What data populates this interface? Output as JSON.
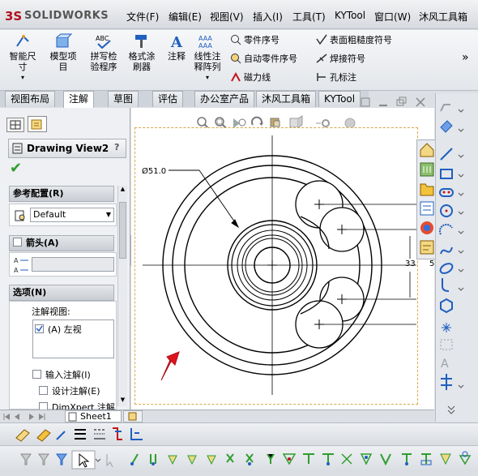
{
  "app": {
    "logo_mark": "3S",
    "logo_text": "SOLIDWORKS"
  },
  "menu": [
    "文件(F)",
    "编辑(E)",
    "视图(V)",
    "插入(I)",
    "工具(T)",
    "KYTool",
    "窗口(W)",
    "沐风工具箱"
  ],
  "ribbon": {
    "big_buttons": [
      {
        "label": "智能尺\n寸",
        "icon": "smart-dimension-icon"
      },
      {
        "label": "模型项\n目",
        "icon": "model-items-icon"
      },
      {
        "label": "拼写检\n验程序",
        "icon": "spell-check-icon"
      },
      {
        "label": "格式涂\n刷器",
        "icon": "format-painter-icon"
      },
      {
        "label": "注释",
        "icon": "note-icon"
      },
      {
        "label": "线性注\n释阵列",
        "icon": "linear-note-pattern-icon"
      }
    ],
    "small_buttons": [
      {
        "label": "零件序号",
        "icon": "balloon-icon"
      },
      {
        "label": "自动零件序号",
        "icon": "auto-balloon-icon"
      },
      {
        "label": "磁力线",
        "icon": "magnetic-line-icon"
      },
      {
        "label": "表面粗糙度符号",
        "icon": "surface-finish-icon"
      },
      {
        "label": "焊接符号",
        "icon": "weld-symbol-icon"
      },
      {
        "label": "孔标注",
        "icon": "hole-callout-icon"
      }
    ],
    "more_glyph": "»"
  },
  "tabs": [
    "视图布局",
    "注解",
    "草图",
    "评估",
    "办公室产品",
    "沐风工具箱",
    "KYTool"
  ],
  "active_tab": "注解",
  "panel": {
    "title": "Drawing View2",
    "help_glyph": "?",
    "ok_glyph": "✔",
    "sections": {
      "config": "参考配置(R)",
      "config_value": "Default",
      "arrow": "箭头(A)",
      "options": "选项(N)",
      "note_view_label": "注解视图:",
      "note_view_item": "(A) 左视",
      "import_note": "输入注解(I)",
      "design_note": "设计注解(E)",
      "dimxpert": "DimXpert 注解"
    }
  },
  "drawing": {
    "dimension_label": "Ø51.0",
    "right_dims": [
      "33",
      "5"
    ],
    "annotation_arrow_color": "#e0141c"
  },
  "sheet_tab": "Sheet1",
  "colors": {
    "accent_blue": "#1f5fbf",
    "red": "#c0141c",
    "dash_gold": "#d6a94a"
  }
}
